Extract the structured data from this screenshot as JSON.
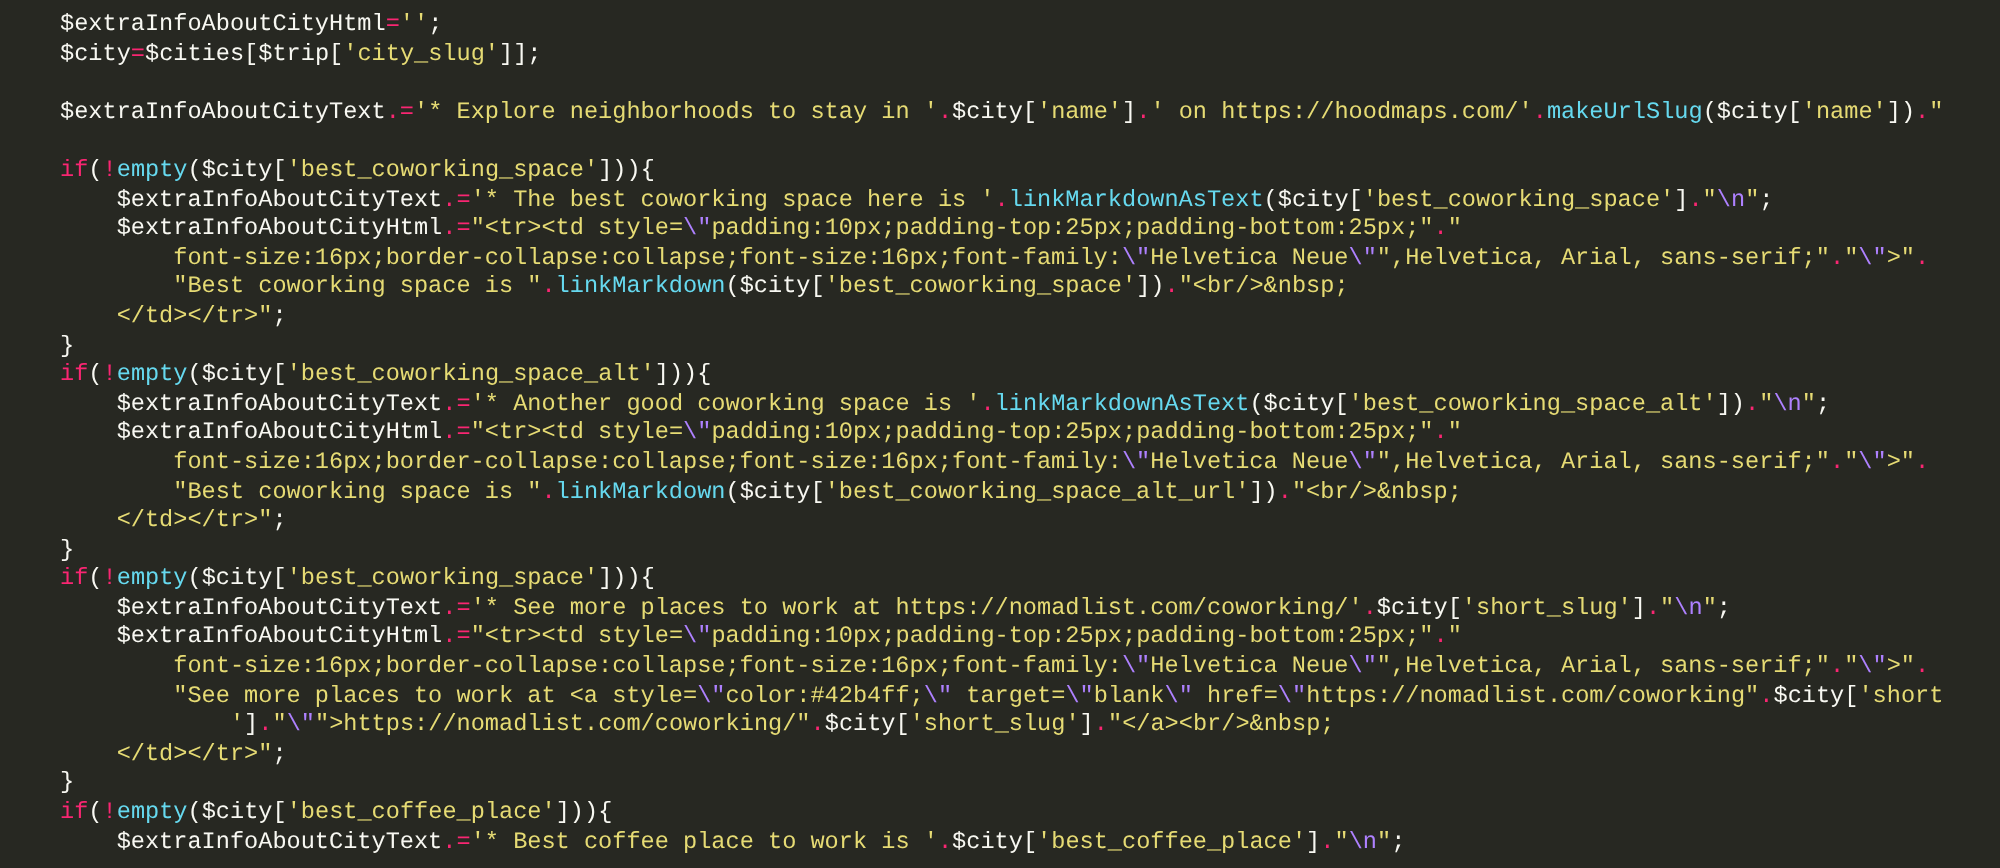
{
  "editor": {
    "blocks": [
      {
        "lines": [
          {
            "tokens": [
              {
                "text": "$extraInfoAboutCityHtml",
                "kind": "plain"
              },
              {
                "text": "=",
                "kind": "operator"
              },
              {
                "text": "''",
                "kind": "string"
              },
              {
                "text": ";",
                "kind": "plain"
              }
            ]
          },
          {
            "tokens": [
              {
                "text": "$city",
                "kind": "plain"
              },
              {
                "text": "=",
                "kind": "operator"
              },
              {
                "text": "$cities[$trip[",
                "kind": "plain"
              },
              {
                "text": "'city_slug'",
                "kind": "string"
              },
              {
                "text": "]];",
                "kind": "plain"
              }
            ]
          }
        ]
      },
      {
        "lines": [
          {
            "tokens": [
              {
                "text": "$extraInfoAboutCityText",
                "kind": "plain"
              },
              {
                "text": ".=",
                "kind": "operator"
              },
              {
                "text": "'* Explore neighborhoods to stay in '",
                "kind": "string"
              },
              {
                "text": ".",
                "kind": "operator"
              },
              {
                "text": "$city[",
                "kind": "plain"
              },
              {
                "text": "'name'",
                "kind": "string"
              },
              {
                "text": "]",
                "kind": "plain"
              },
              {
                "text": ".",
                "kind": "operator"
              },
              {
                "text": "' on https://hoodmaps.com/'",
                "kind": "string"
              },
              {
                "text": ".",
                "kind": "operator"
              },
              {
                "text": "makeUrlSlug",
                "kind": "function"
              },
              {
                "text": "($city[",
                "kind": "plain"
              },
              {
                "text": "'name'",
                "kind": "string"
              },
              {
                "text": "])",
                "kind": "plain"
              },
              {
                "text": ".",
                "kind": "operator"
              },
              {
                "text": "\"",
                "kind": "string"
              }
            ]
          }
        ]
      },
      {
        "lines": [
          {
            "tokens": [
              {
                "text": "if",
                "kind": "keyword"
              },
              {
                "text": "(",
                "kind": "plain"
              },
              {
                "text": "!",
                "kind": "operator"
              },
              {
                "text": "empty",
                "kind": "function"
              },
              {
                "text": "($city[",
                "kind": "plain"
              },
              {
                "text": "'best_coworking_space'",
                "kind": "string"
              },
              {
                "text": "])){",
                "kind": "plain"
              }
            ]
          },
          {
            "tokens": [
              {
                "text": "    $extraInfoAboutCityText",
                "kind": "plain"
              },
              {
                "text": ".=",
                "kind": "operator"
              },
              {
                "text": "'* The best coworking space here is '",
                "kind": "string"
              },
              {
                "text": ".",
                "kind": "operator"
              },
              {
                "text": "linkMarkdownAsText",
                "kind": "function"
              },
              {
                "text": "($city[",
                "kind": "plain"
              },
              {
                "text": "'best_coworking_space'",
                "kind": "string"
              },
              {
                "text": "]",
                "kind": "plain"
              },
              {
                "text": ".",
                "kind": "operator"
              },
              {
                "text": "\"",
                "kind": "string"
              },
              {
                "text": "\\n",
                "kind": "escape"
              },
              {
                "text": "\"",
                "kind": "string"
              },
              {
                "text": ";",
                "kind": "plain"
              }
            ]
          },
          {
            "tokens": [
              {
                "text": "    $extraInfoAboutCityHtml",
                "kind": "plain"
              },
              {
                "text": ".=",
                "kind": "operator"
              },
              {
                "text": "\"<tr><td style=",
                "kind": "string"
              },
              {
                "text": "\\\"",
                "kind": "escape"
              },
              {
                "text": "padding:10px;padding-top:25px;padding-bottom:25px;\"",
                "kind": "string"
              },
              {
                "text": ".",
                "kind": "operator"
              },
              {
                "text": "\"",
                "kind": "string"
              }
            ]
          },
          {
            "tokens": [
              {
                "text": "        font-size:16px;border-collapse:collapse;font-size:16px;font-family:",
                "kind": "string"
              },
              {
                "text": "\\\"",
                "kind": "escape"
              },
              {
                "text": "Helvetica Neue",
                "kind": "string"
              },
              {
                "text": "\\\"",
                "kind": "escape"
              },
              {
                "text": "\",Helvetica, Arial, sans-serif;\"",
                "kind": "string"
              },
              {
                "text": ".",
                "kind": "operator"
              },
              {
                "text": "\"",
                "kind": "string"
              },
              {
                "text": "\\\"",
                "kind": "escape"
              },
              {
                "text": ">\"",
                "kind": "string"
              },
              {
                "text": ".",
                "kind": "operator"
              }
            ]
          },
          {
            "tokens": [
              {
                "text": "        \"Best coworking space is \"",
                "kind": "string"
              },
              {
                "text": ".",
                "kind": "operator"
              },
              {
                "text": "linkMarkdown",
                "kind": "function"
              },
              {
                "text": "($city[",
                "kind": "plain"
              },
              {
                "text": "'best_coworking_space'",
                "kind": "string"
              },
              {
                "text": "])",
                "kind": "plain"
              },
              {
                "text": ".",
                "kind": "operator"
              },
              {
                "text": "\"<br/>&nbsp;",
                "kind": "string"
              }
            ]
          },
          {
            "tokens": [
              {
                "text": "    </td></tr>\"",
                "kind": "string"
              },
              {
                "text": ";",
                "kind": "plain"
              }
            ]
          },
          {
            "tokens": [
              {
                "text": "}",
                "kind": "plain"
              }
            ]
          },
          {
            "tokens": [
              {
                "text": "if",
                "kind": "keyword"
              },
              {
                "text": "(",
                "kind": "plain"
              },
              {
                "text": "!",
                "kind": "operator"
              },
              {
                "text": "empty",
                "kind": "function"
              },
              {
                "text": "($city[",
                "kind": "plain"
              },
              {
                "text": "'best_coworking_space_alt'",
                "kind": "string"
              },
              {
                "text": "])){",
                "kind": "plain"
              }
            ]
          },
          {
            "tokens": [
              {
                "text": "    $extraInfoAboutCityText",
                "kind": "plain"
              },
              {
                "text": ".=",
                "kind": "operator"
              },
              {
                "text": "'* Another good coworking space is '",
                "kind": "string"
              },
              {
                "text": ".",
                "kind": "operator"
              },
              {
                "text": "linkMarkdownAsText",
                "kind": "function"
              },
              {
                "text": "($city[",
                "kind": "plain"
              },
              {
                "text": "'best_coworking_space_alt'",
                "kind": "string"
              },
              {
                "text": "])",
                "kind": "plain"
              },
              {
                "text": ".",
                "kind": "operator"
              },
              {
                "text": "\"",
                "kind": "string"
              },
              {
                "text": "\\n",
                "kind": "escape"
              },
              {
                "text": "\"",
                "kind": "string"
              },
              {
                "text": ";",
                "kind": "plain"
              }
            ]
          },
          {
            "tokens": [
              {
                "text": "    $extraInfoAboutCityHtml",
                "kind": "plain"
              },
              {
                "text": ".=",
                "kind": "operator"
              },
              {
                "text": "\"<tr><td style=",
                "kind": "string"
              },
              {
                "text": "\\\"",
                "kind": "escape"
              },
              {
                "text": "padding:10px;padding-top:25px;padding-bottom:25px;\"",
                "kind": "string"
              },
              {
                "text": ".",
                "kind": "operator"
              },
              {
                "text": "\"",
                "kind": "string"
              }
            ]
          },
          {
            "tokens": [
              {
                "text": "        font-size:16px;border-collapse:collapse;font-size:16px;font-family:",
                "kind": "string"
              },
              {
                "text": "\\\"",
                "kind": "escape"
              },
              {
                "text": "Helvetica Neue",
                "kind": "string"
              },
              {
                "text": "\\\"",
                "kind": "escape"
              },
              {
                "text": "\",Helvetica, Arial, sans-serif;\"",
                "kind": "string"
              },
              {
                "text": ".",
                "kind": "operator"
              },
              {
                "text": "\"",
                "kind": "string"
              },
              {
                "text": "\\\"",
                "kind": "escape"
              },
              {
                "text": ">\"",
                "kind": "string"
              },
              {
                "text": ".",
                "kind": "operator"
              }
            ]
          },
          {
            "tokens": [
              {
                "text": "        \"Best coworking space is \"",
                "kind": "string"
              },
              {
                "text": ".",
                "kind": "operator"
              },
              {
                "text": "linkMarkdown",
                "kind": "function"
              },
              {
                "text": "($city[",
                "kind": "plain"
              },
              {
                "text": "'best_coworking_space_alt_url'",
                "kind": "string"
              },
              {
                "text": "])",
                "kind": "plain"
              },
              {
                "text": ".",
                "kind": "operator"
              },
              {
                "text": "\"<br/>&nbsp;",
                "kind": "string"
              }
            ]
          },
          {
            "tokens": [
              {
                "text": "    </td></tr>\"",
                "kind": "string"
              },
              {
                "text": ";",
                "kind": "plain"
              }
            ]
          },
          {
            "tokens": [
              {
                "text": "}",
                "kind": "plain"
              }
            ]
          },
          {
            "tokens": [
              {
                "text": "if",
                "kind": "keyword"
              },
              {
                "text": "(",
                "kind": "plain"
              },
              {
                "text": "!",
                "kind": "operator"
              },
              {
                "text": "empty",
                "kind": "function"
              },
              {
                "text": "($city[",
                "kind": "plain"
              },
              {
                "text": "'best_coworking_space'",
                "kind": "string"
              },
              {
                "text": "])){",
                "kind": "plain"
              }
            ]
          },
          {
            "tokens": [
              {
                "text": "    $extraInfoAboutCityText",
                "kind": "plain"
              },
              {
                "text": ".=",
                "kind": "operator"
              },
              {
                "text": "'* See more places to work at https://nomadlist.com/coworking/'",
                "kind": "string"
              },
              {
                "text": ".",
                "kind": "operator"
              },
              {
                "text": "$city[",
                "kind": "plain"
              },
              {
                "text": "'short_slug'",
                "kind": "string"
              },
              {
                "text": "]",
                "kind": "plain"
              },
              {
                "text": ".",
                "kind": "operator"
              },
              {
                "text": "\"",
                "kind": "string"
              },
              {
                "text": "\\n",
                "kind": "escape"
              },
              {
                "text": "\"",
                "kind": "string"
              },
              {
                "text": ";",
                "kind": "plain"
              }
            ]
          },
          {
            "tokens": [
              {
                "text": "    $extraInfoAboutCityHtml",
                "kind": "plain"
              },
              {
                "text": ".=",
                "kind": "operator"
              },
              {
                "text": "\"<tr><td style=",
                "kind": "string"
              },
              {
                "text": "\\\"",
                "kind": "escape"
              },
              {
                "text": "padding:10px;padding-top:25px;padding-bottom:25px;\"",
                "kind": "string"
              },
              {
                "text": ".",
                "kind": "operator"
              },
              {
                "text": "\"",
                "kind": "string"
              }
            ]
          },
          {
            "tokens": [
              {
                "text": "        font-size:16px;border-collapse:collapse;font-size:16px;font-family:",
                "kind": "string"
              },
              {
                "text": "\\\"",
                "kind": "escape"
              },
              {
                "text": "Helvetica Neue",
                "kind": "string"
              },
              {
                "text": "\\\"",
                "kind": "escape"
              },
              {
                "text": "\",Helvetica, Arial, sans-serif;\"",
                "kind": "string"
              },
              {
                "text": ".",
                "kind": "operator"
              },
              {
                "text": "\"",
                "kind": "string"
              },
              {
                "text": "\\\"",
                "kind": "escape"
              },
              {
                "text": ">\"",
                "kind": "string"
              },
              {
                "text": ".",
                "kind": "operator"
              }
            ]
          },
          {
            "tokens": [
              {
                "text": "        \"See more places to work at <a style=",
                "kind": "string"
              },
              {
                "text": "\\\"",
                "kind": "escape"
              },
              {
                "text": "color:#42b4ff;",
                "kind": "string"
              },
              {
                "text": "\\\"",
                "kind": "escape"
              },
              {
                "text": " target=",
                "kind": "string"
              },
              {
                "text": "\\\"",
                "kind": "escape"
              },
              {
                "text": "blank",
                "kind": "string"
              },
              {
                "text": "\\\"",
                "kind": "escape"
              },
              {
                "text": " href=",
                "kind": "string"
              },
              {
                "text": "\\\"",
                "kind": "escape"
              },
              {
                "text": "https://nomadlist.com/coworking\"",
                "kind": "string"
              },
              {
                "text": ".",
                "kind": "operator"
              },
              {
                "text": "$city[",
                "kind": "plain"
              },
              {
                "text": "'short",
                "kind": "string"
              }
            ]
          },
          {
            "tokens": [
              {
                "text": "            '",
                "kind": "string"
              },
              {
                "text": "]",
                "kind": "plain"
              },
              {
                "text": ".",
                "kind": "operator"
              },
              {
                "text": "\"",
                "kind": "string"
              },
              {
                "text": "\\\"",
                "kind": "escape"
              },
              {
                "text": "\">https://nomadlist.com/coworking/\"",
                "kind": "string"
              },
              {
                "text": ".",
                "kind": "operator"
              },
              {
                "text": "$city[",
                "kind": "plain"
              },
              {
                "text": "'short_slug'",
                "kind": "string"
              },
              {
                "text": "]",
                "kind": "plain"
              },
              {
                "text": ".",
                "kind": "operator"
              },
              {
                "text": "\"</a><br/>&nbsp;",
                "kind": "string"
              }
            ]
          },
          {
            "tokens": [
              {
                "text": "    </td></tr>\"",
                "kind": "string"
              },
              {
                "text": ";",
                "kind": "plain"
              }
            ]
          },
          {
            "tokens": [
              {
                "text": "}",
                "kind": "plain"
              }
            ]
          },
          {
            "tokens": [
              {
                "text": "if",
                "kind": "keyword"
              },
              {
                "text": "(",
                "kind": "plain"
              },
              {
                "text": "!",
                "kind": "operator"
              },
              {
                "text": "empty",
                "kind": "function"
              },
              {
                "text": "($city[",
                "kind": "plain"
              },
              {
                "text": "'best_coffee_place'",
                "kind": "string"
              },
              {
                "text": "])){",
                "kind": "plain"
              }
            ]
          },
          {
            "tokens": [
              {
                "text": "    $extraInfoAboutCityText",
                "kind": "plain"
              },
              {
                "text": ".=",
                "kind": "operator"
              },
              {
                "text": "'* Best coffee place to work is '",
                "kind": "string"
              },
              {
                "text": ".",
                "kind": "operator"
              },
              {
                "text": "$city[",
                "kind": "plain"
              },
              {
                "text": "'best_coffee_place'",
                "kind": "string"
              },
              {
                "text": "]",
                "kind": "plain"
              },
              {
                "text": ".",
                "kind": "operator"
              },
              {
                "text": "\"",
                "kind": "string"
              },
              {
                "text": "\\n",
                "kind": "escape"
              },
              {
                "text": "\"",
                "kind": "string"
              },
              {
                "text": ";",
                "kind": "plain"
              }
            ]
          }
        ]
      }
    ]
  }
}
